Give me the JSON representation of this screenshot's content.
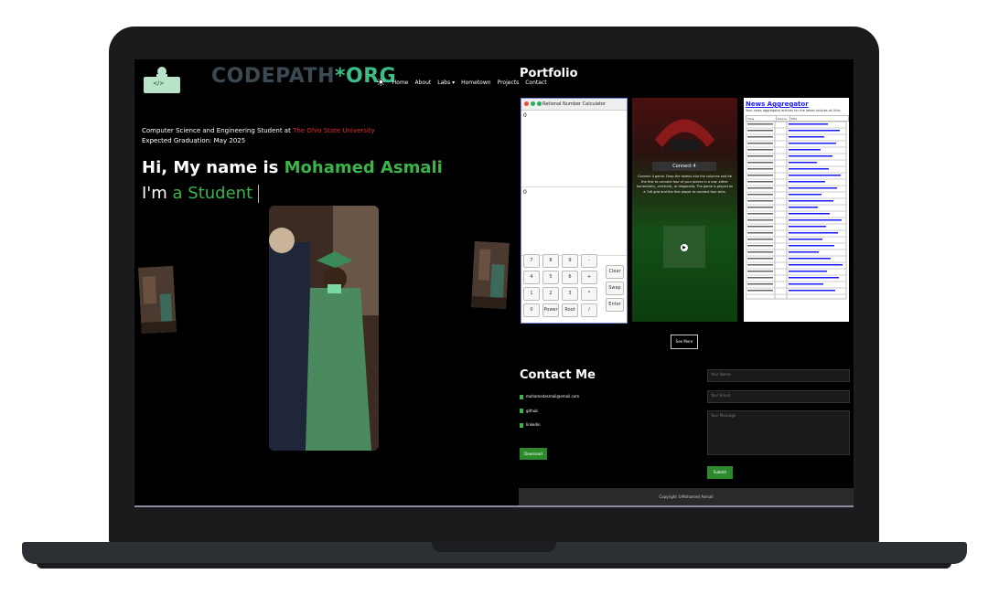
{
  "brand": {
    "part1": "CODEPATH",
    "part2": "*ORG",
    "logo_text": "</>"
  },
  "nav": {
    "items": [
      "Home",
      "About",
      "Labs ▾",
      "Hometown",
      "Projects",
      "Contact"
    ]
  },
  "hero": {
    "line1_prefix": "Computer Science and Engineering Student at",
    "university": "The Ohio State University",
    "line2": "Expected Graduation: May 2025",
    "greeting": "Hi, My name is",
    "name": "Mohamed Asmali",
    "role_prefix": "I'm",
    "role_typed": "a Student"
  },
  "portfolio": {
    "title": "Portfolio",
    "calculator": {
      "title": "Rational Number Calculator",
      "display_top": "0",
      "display_bottom": "0",
      "keys": [
        "7",
        "8",
        "9",
        "-",
        "4",
        "5",
        "6",
        "+",
        "1",
        "2",
        "3",
        "*",
        "0",
        "Power",
        "Root",
        "/"
      ],
      "side_keys": [
        "Clear",
        "Swap",
        "Enter"
      ]
    },
    "game": {
      "label": "Connect 4",
      "description": "Connect 4 game. Drop the tokens into the columns and be the first to connect four of your pieces in a row, either horizontally, vertically, or diagonally. The game is played on a 7x6 grid and the first player to connect four wins."
    },
    "news": {
      "title": "News Aggregator",
      "subtitle": "Your news aggregator articles for the latest articles at Ohio",
      "headers": [
        "Time",
        "Source",
        "Title"
      ]
    },
    "see_all": "See More"
  },
  "contact": {
    "title": "Contact Me",
    "items": [
      "mohamedasmali@email.com",
      "github",
      "linkedin"
    ],
    "resume_button": "Download",
    "fields": {
      "name": "Your Name",
      "email": "Your Email",
      "message": "Your Message"
    },
    "submit": "Submit"
  },
  "footer": {
    "text": "Copyright ©Mohamed Asmali"
  },
  "colors": {
    "accent_green": "#3bb54a",
    "brand_teal": "#3bbf86",
    "osu_red": "#e02b2b"
  }
}
